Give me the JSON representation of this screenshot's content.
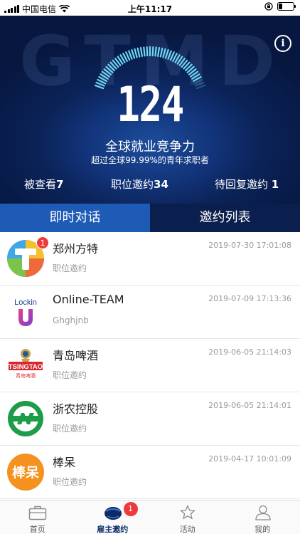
{
  "status_bar": {
    "carrier": "中国电信",
    "time": "上午11:17"
  },
  "hero": {
    "watermark": "GTMD",
    "info_icon": "info-icon",
    "score": "124",
    "gauge_level": 0.95,
    "title": "全球就业竞争力",
    "subtitle": "超过全球99.99%的青年求职者",
    "stats": [
      {
        "label": "被查看",
        "value": "7"
      },
      {
        "label": "职位邀约",
        "value": "34"
      },
      {
        "label": "待回复邀约 ",
        "value": "1"
      }
    ]
  },
  "tabs": [
    {
      "label": "即时对话",
      "active": true
    },
    {
      "label": "邀约列表",
      "active": false
    }
  ],
  "conversations": [
    {
      "name": "郑州方特",
      "sub": "职位邀约",
      "time": "2019-07-30 17:01:08",
      "badge": "1",
      "avatar": "fangte-logo"
    },
    {
      "name": "Online-TEAM",
      "sub": "Ghghjnb",
      "time": "2019-07-09 17:13:36",
      "badge": "",
      "avatar": "lockin-logo",
      "avatar_text": "Lockin"
    },
    {
      "name": "青岛啤酒",
      "sub": "职位邀约",
      "time": "2019-06-05 21:14:03",
      "badge": "",
      "avatar": "tsingtao-logo",
      "avatar_text": "TSINGTAO",
      "avatar_text2": "青岛啤酒"
    },
    {
      "name": "浙农控股",
      "sub": "职位邀约",
      "time": "2019-06-05 21:14:01",
      "badge": "",
      "avatar": "zhenong-logo"
    },
    {
      "name": "棒呆",
      "sub": "职位邀约",
      "time": "2019-04-17 10:01:09",
      "badge": "",
      "avatar": "bangdai-logo",
      "avatar_text": "棒呆"
    }
  ],
  "bottom_nav": [
    {
      "label": "首页",
      "icon": "briefcase-icon",
      "active": false
    },
    {
      "label": "雇主邀约",
      "icon": "employer-avatar-icon",
      "active": true,
      "badge": "1"
    },
    {
      "label": "活动",
      "icon": "star-icon",
      "active": false
    },
    {
      "label": "我的",
      "icon": "person-icon",
      "active": false
    }
  ],
  "colors": {
    "accent": "#1e5bb7",
    "hero_dark": "#0b1f4e",
    "badge": "#ee3a3a",
    "gauge": "#6fd6f4"
  }
}
